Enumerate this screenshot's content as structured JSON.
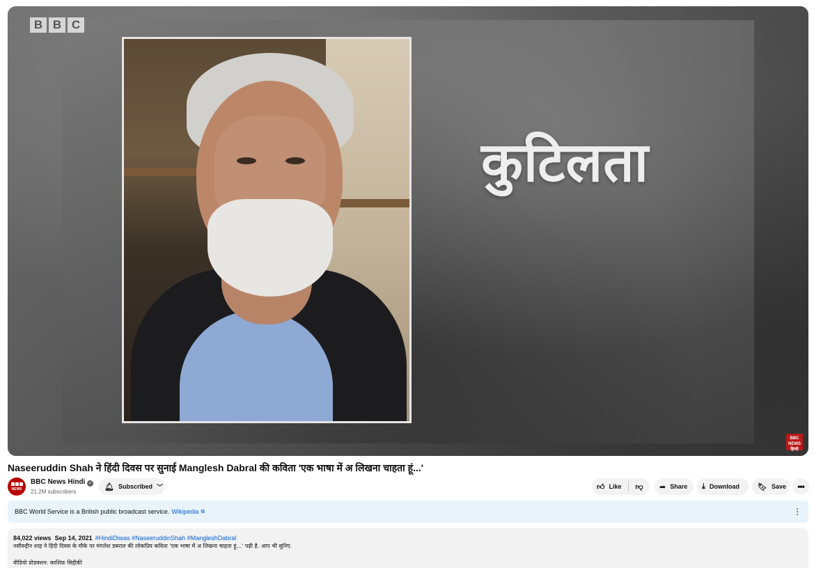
{
  "video": {
    "logo_letters": [
      "B",
      "B",
      "C"
    ],
    "overlay_word": "कुटिलता",
    "corner_badge": "BBC NEWS हिन्दी"
  },
  "title": "Naseeruddin Shah ने हिंदी दिवस पर सुनाई Manglesh Dabral की कविता 'एक भाषा में अ लिखना चाहता हूं...'",
  "channel": {
    "name": "BBC News Hindi",
    "verified": "✓",
    "subscribers": "21.2M subscribers",
    "avatar_text": "NEWS"
  },
  "actions": {
    "subscribed": "Subscribed",
    "like": "Like",
    "share": "Share",
    "download": "Download",
    "save": "Save"
  },
  "info_panel": {
    "text": "BBC World Service is a British public broadcast service.",
    "link": "Wikipedia"
  },
  "description": {
    "views": "84,022 views",
    "date": "Sep 14, 2021",
    "hashtags": "#HindiDiwas #NaseeruddinShah #MangleshDabral",
    "line1": "नसीरुद्दीन शाह ने हिंदी दिवस के मौके पर मंगलेश डबराल की लोकप्रिय कविता 'एक भाषा में अ लिखना चाहता हूं...' पढ़ी है. आप भी सुनिए.",
    "line2": "वीडियो प्रोडक्शन: काशिफ़ सिद्दीक़ी"
  },
  "icons": {
    "bell": "bell-icon",
    "like": "thumbs-up-icon",
    "dislike": "thumbs-down-icon",
    "share": "share-arrow-icon",
    "download": "download-icon",
    "save": "bookmark-icon",
    "more": "more-horizontal-icon",
    "external": "external-link-icon",
    "kebab": "more-vertical-icon"
  }
}
